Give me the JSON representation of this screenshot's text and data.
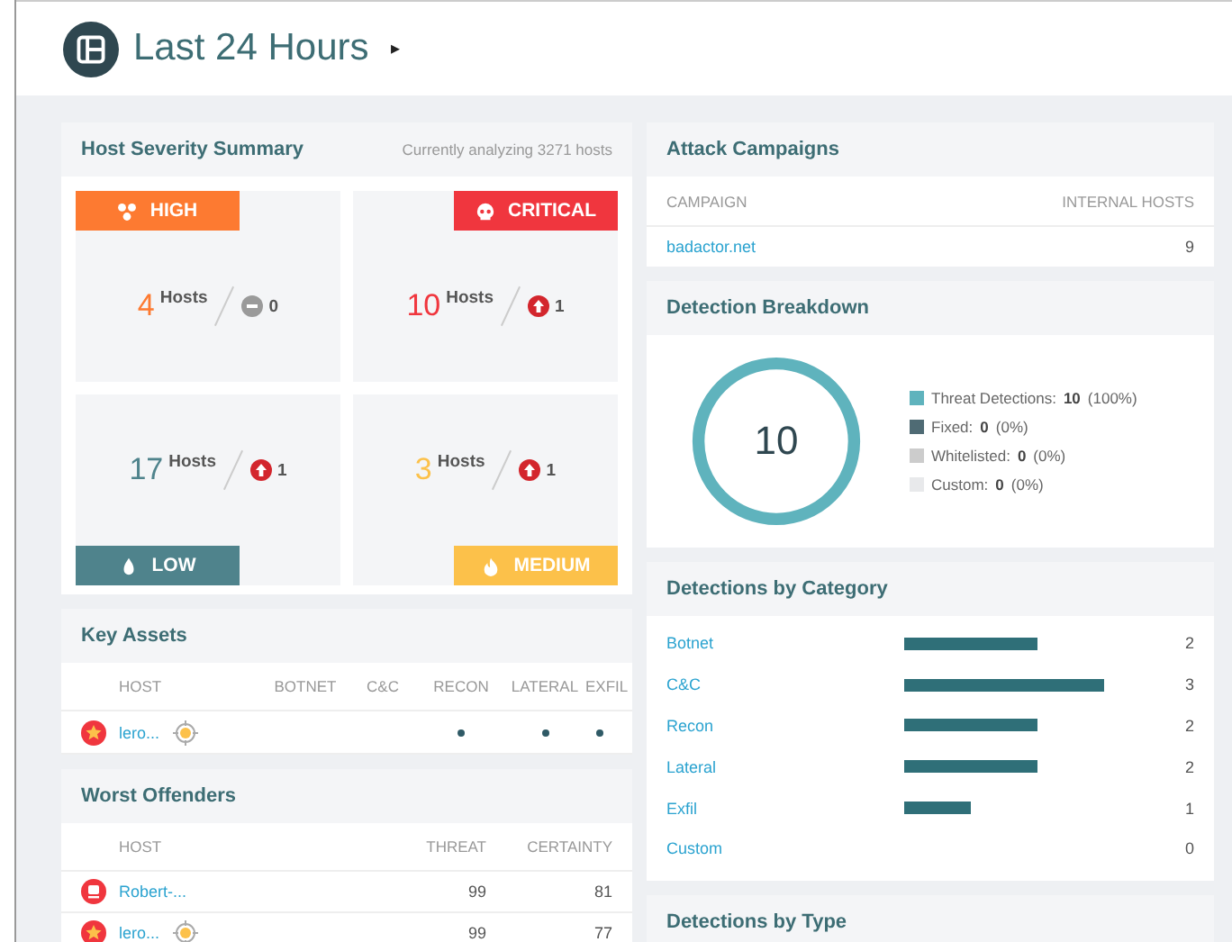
{
  "header": {
    "title": "Last 24 Hours",
    "caret": "▸"
  },
  "host_severity": {
    "title": "Host Severity Summary",
    "subtitle": "Currently analyzing 3271 hosts",
    "tiles": [
      {
        "kind": "high",
        "label": "HIGH",
        "count": "4",
        "unit": "Hosts",
        "change": {
          "kind": "none",
          "value": "0"
        }
      },
      {
        "kind": "critical",
        "label": "CRITICAL",
        "count": "10",
        "unit": "Hosts",
        "change": {
          "kind": "up",
          "value": "1"
        }
      },
      {
        "kind": "low",
        "label": "LOW",
        "count": "17",
        "unit": "Hosts",
        "change": {
          "kind": "up",
          "value": "1"
        }
      },
      {
        "kind": "medium",
        "label": "MEDIUM",
        "count": "3",
        "unit": "Hosts",
        "change": {
          "kind": "up",
          "value": "1"
        }
      }
    ]
  },
  "key_assets": {
    "title": "Key Assets",
    "columns": [
      "HOST",
      "BOTNET",
      "C&C",
      "RECON",
      "LATERAL",
      "EXFIL"
    ],
    "rows": [
      {
        "kind": "star",
        "host": "lero...",
        "targeted": true,
        "flags": [
          false,
          false,
          true,
          true,
          true
        ]
      }
    ]
  },
  "worst_offenders": {
    "title": "Worst Offenders",
    "columns": [
      "HOST",
      "THREAT",
      "CERTAINTY"
    ],
    "rows": [
      {
        "kind": "computer",
        "host": "Robert-...",
        "targeted": false,
        "threat": "99",
        "certainty": "81"
      },
      {
        "kind": "star",
        "host": "lero...",
        "targeted": true,
        "threat": "99",
        "certainty": "77"
      }
    ]
  },
  "attack_campaigns": {
    "title": "Attack Campaigns",
    "columns": [
      "CAMPAIGN",
      "INTERNAL HOSTS"
    ],
    "rows": [
      {
        "campaign": "badactor.net",
        "hosts": "9"
      }
    ]
  },
  "detection_breakdown": {
    "title": "Detection Breakdown",
    "total": "10",
    "legend": [
      {
        "label": "Threat Detections:",
        "value": "10",
        "percent": "(100%)",
        "color": "#5fb3bd"
      },
      {
        "label": "Fixed:",
        "value": "0",
        "percent": "(0%)",
        "color": "#4f6b74"
      },
      {
        "label": "Whitelisted:",
        "value": "0",
        "percent": "(0%)",
        "color": "#cccccc"
      },
      {
        "label": "Custom:",
        "value": "0",
        "percent": "(0%)",
        "color": "#e8e9eb"
      }
    ]
  },
  "detections_by_category": {
    "title": "Detections by Category",
    "rows": [
      {
        "label": "Botnet",
        "count": "2"
      },
      {
        "label": "C&C",
        "count": "3"
      },
      {
        "label": "Recon",
        "count": "2"
      },
      {
        "label": "Lateral",
        "count": "2"
      },
      {
        "label": "Exfil",
        "count": "1"
      },
      {
        "label": "Custom",
        "count": "0"
      }
    ]
  },
  "detections_by_type": {
    "title": "Detections by Type"
  }
}
